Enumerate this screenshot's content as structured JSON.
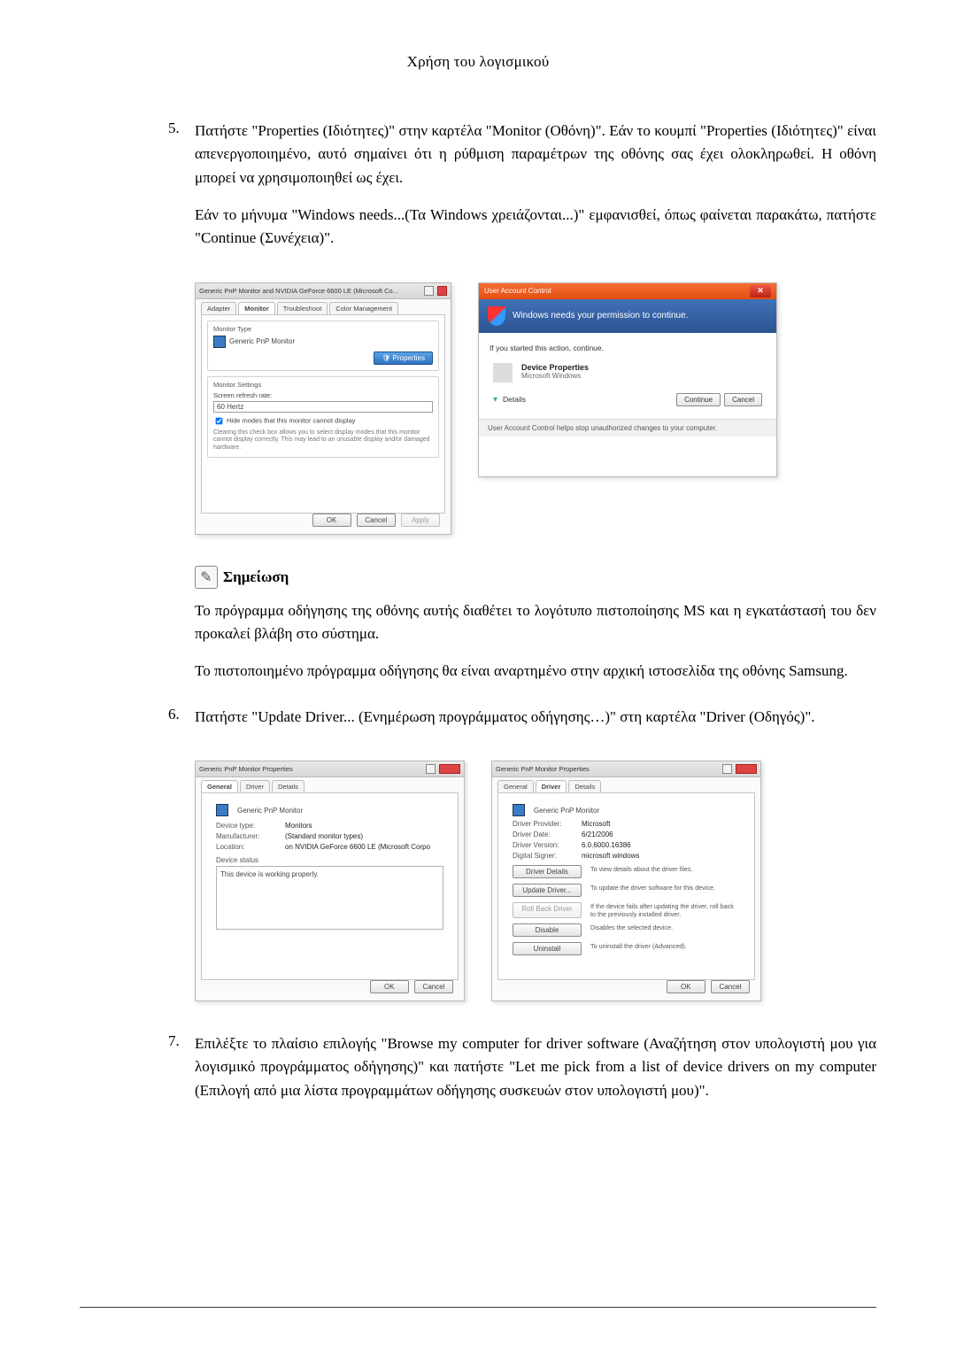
{
  "header": "Χρήση του λογισμικού",
  "step5": {
    "num": "5.",
    "para1": "Πατήστε \"Properties (Ιδιότητες)\" στην καρτέλα \"Monitor (Οθόνη)\". Εάν το κουμπί \"Properties (Ιδιότητες)\" είναι απενεργοποιημένο, αυτό σημαίνει ότι η ρύθμιση παραμέτρων της οθόνης σας έχει ολοκληρωθεί. Η οθόνη μπορεί να χρησιμοποιηθεί ως έχει.",
    "para2": "Εάν το μήνυμα \"Windows needs...(Τα Windows χρειάζονται...)\" εμφανισθεί, όπως φαίνεται παρακάτω, πατήστε \"Continue (Συνέχεια)\".",
    "win_monitor": {
      "title": "Generic PnP Monitor and NVIDIA GeForce 6600 LE (Microsoft Co...",
      "tabs": [
        "Adapter",
        "Monitor",
        "Troubleshoot",
        "Color Management"
      ],
      "group_monitor_type": "Monitor Type",
      "monitor_name": "Generic PnP Monitor",
      "properties_btn": "Properties",
      "group_monitor_settings": "Monitor Settings",
      "refresh_label": "Screen refresh rate:",
      "refresh_value": "60 Hertz",
      "hide_modes": "Hide modes that this monitor cannot display",
      "hide_modes_desc": "Clearing this check box allows you to select display modes that this monitor cannot display correctly. This may lead to an unusable display and/or damaged hardware.",
      "ok": "OK",
      "cancel": "Cancel",
      "apply": "Apply"
    },
    "uac": {
      "title": "User Account Control",
      "banner": "Windows needs your permission to continue.",
      "if_started": "If you started this action, continue.",
      "item_title": "Device Properties",
      "item_sub": "Microsoft Windows",
      "details": "Details",
      "continue": "Continue",
      "cancel": "Cancel",
      "footer": "User Account Control helps stop unauthorized changes to your computer."
    }
  },
  "note": {
    "title": "Σημείωση",
    "para1": "Το πρόγραμμα οδήγησης της οθόνης αυτής διαθέτει το λογότυπο πιστοποίησης MS και η εγκατάστασή του δεν προκαλεί βλάβη στο σύστημα.",
    "para2": "Το πιστοποιημένο πρόγραμμα οδήγησης θα είναι αναρτημένο στην αρχική ιστοσελίδα της οθόνης Samsung."
  },
  "step6": {
    "num": "6.",
    "para": "Πατήστε \"Update Driver... (Ενημέρωση προγράμματος οδήγησης…)\" στη καρτέλα \"Driver (Οδηγός)\".",
    "win_general": {
      "title": "Generic PnP Monitor Properties",
      "tabs": [
        "General",
        "Driver",
        "Details"
      ],
      "name": "Generic PnP Monitor",
      "rows": [
        {
          "k": "Device type:",
          "v": "Monitors"
        },
        {
          "k": "Manufacturer:",
          "v": "(Standard monitor types)"
        },
        {
          "k": "Location:",
          "v": "on NVIDIA GeForce 6600 LE (Microsoft Corpo"
        }
      ],
      "status_label": "Device status",
      "status_text": "This device is working properly.",
      "ok": "OK",
      "cancel": "Cancel"
    },
    "win_driver": {
      "title": "Generic PnP Monitor Properties",
      "tabs": [
        "General",
        "Driver",
        "Details"
      ],
      "name": "Generic PnP Monitor",
      "rows": [
        {
          "k": "Driver Provider:",
          "v": "Microsoft"
        },
        {
          "k": "Driver Date:",
          "v": "6/21/2006"
        },
        {
          "k": "Driver Version:",
          "v": "6.0.6000.16386"
        },
        {
          "k": "Digital Signer:",
          "v": "microsoft windows"
        }
      ],
      "buttons": [
        {
          "label": "Driver Details",
          "desc": "To view details about the driver files."
        },
        {
          "label": "Update Driver...",
          "desc": "To update the driver software for this device."
        },
        {
          "label": "Roll Back Driver",
          "desc": "If the device fails after updating the driver, roll back to the previously installed driver."
        },
        {
          "label": "Disable",
          "desc": "Disables the selected device."
        },
        {
          "label": "Uninstall",
          "desc": "To uninstall the driver (Advanced)."
        }
      ],
      "ok": "OK",
      "cancel": "Cancel"
    }
  },
  "step7": {
    "num": "7.",
    "para": "Επιλέξτε το πλαίσιο επιλογής \"Browse my computer for driver software (Αναζήτηση στον υπολογιστή μου για λογισμικό προγράμματος οδήγησης)\" και πατήστε \"Let me pick from a list of device drivers on my computer (Επιλογή από μια λίστα προγραμμάτων οδήγησης συσκευών στον υπολογιστή μου)\"."
  }
}
